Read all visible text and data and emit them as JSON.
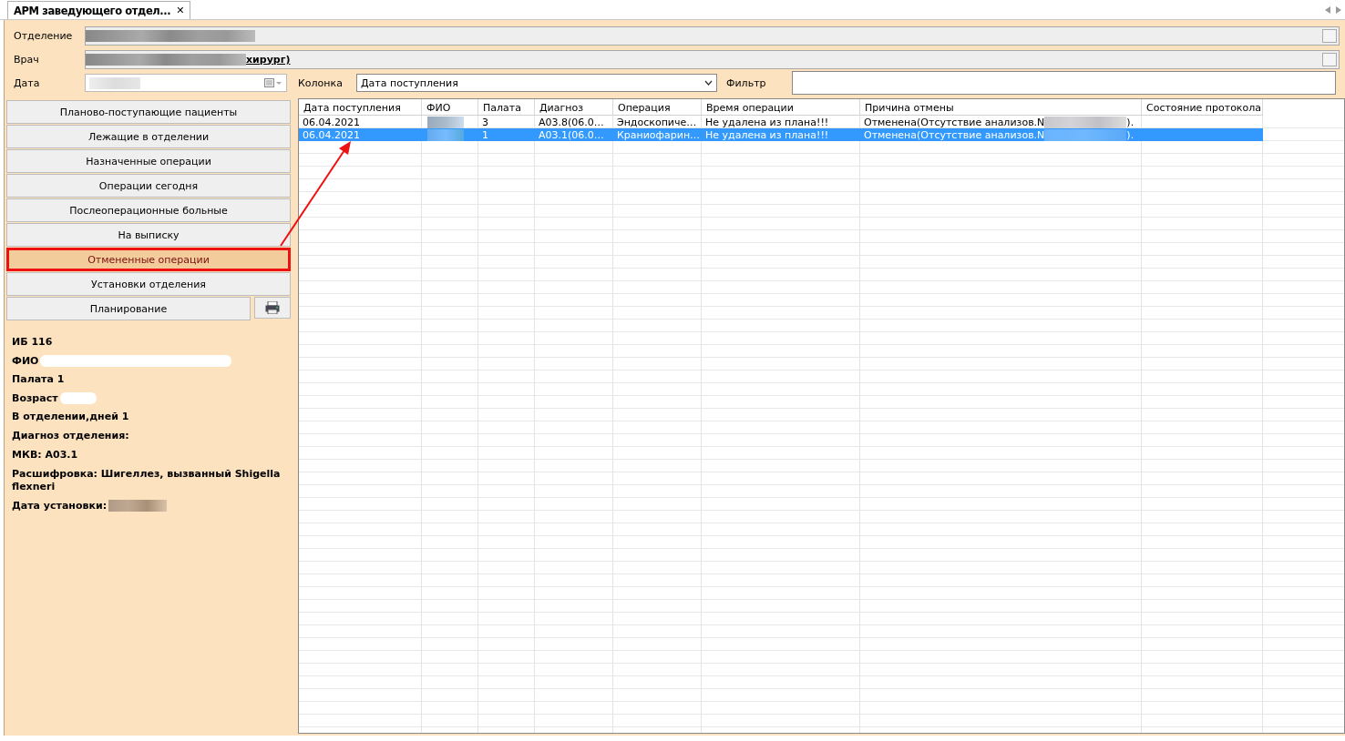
{
  "tab": {
    "title": "АРМ заведующего отдел...",
    "close": "✕"
  },
  "form": {
    "department": {
      "label": "Отделение"
    },
    "doctor": {
      "label": "Врач",
      "value": "хирург)"
    },
    "date": {
      "label": "Дата"
    },
    "column": {
      "label": "Колонка",
      "value": "Дата поступления"
    },
    "filter": {
      "label": "Фильтр"
    }
  },
  "nav_buttons": [
    {
      "label": "Планово-поступающие пациенты",
      "selected": false
    },
    {
      "label": "Лежащие в отделении",
      "selected": false
    },
    {
      "label": "Назначенные операции",
      "selected": false
    },
    {
      "label": "Операции сегодня",
      "selected": false
    },
    {
      "label": "Послеоперационные больные",
      "selected": false
    },
    {
      "label": "На выписку",
      "selected": false
    },
    {
      "label": "Отмененные операции",
      "selected": true
    },
    {
      "label": "Установки отделения",
      "selected": false
    }
  ],
  "planning": {
    "label": "Планирование"
  },
  "patient_info": [
    {
      "text": "ИБ 116",
      "redacted": false
    },
    {
      "text": "ФИО",
      "redacted": true
    },
    {
      "text": "Палата 1",
      "redacted": false
    },
    {
      "text": "Возраст",
      "redacted": true
    },
    {
      "text": "В отделении,дней 1",
      "redacted": false
    },
    {
      "text": "Диагноз отделения:",
      "redacted": false
    },
    {
      "text": "МКВ: A03.1",
      "redacted": false
    },
    {
      "text": "Расшифровка: Шигеллез, вызванный Shigella flexneri",
      "redacted": false
    },
    {
      "text": "Дата установки:",
      "redacted": true
    }
  ],
  "table": {
    "columns": [
      "Дата поступления",
      "ФИО",
      "Палата",
      "Диагноз",
      "Операция",
      "Время операции",
      "Причина отмены",
      "Состояние протокола"
    ],
    "rows": [
      {
        "date": "06.04.2021",
        "ward": "3",
        "diagnosis": "A03.8(06.0…",
        "operation": "Эндоскопиче…",
        "operation_time": "Не удалена из плана!!!",
        "reason_start": "Отменена(Отсутствие анализов.N",
        "reason_end": ").",
        "selected": false
      },
      {
        "date": "06.04.2021",
        "ward": "1",
        "diagnosis": "A03.1(06.0…",
        "operation": "Краниофарин…",
        "operation_time": "Не удалена из плана!!!",
        "reason_start": "Отменена(Отсутствие анализов.N",
        "reason_end": ").",
        "selected": true
      }
    ]
  }
}
